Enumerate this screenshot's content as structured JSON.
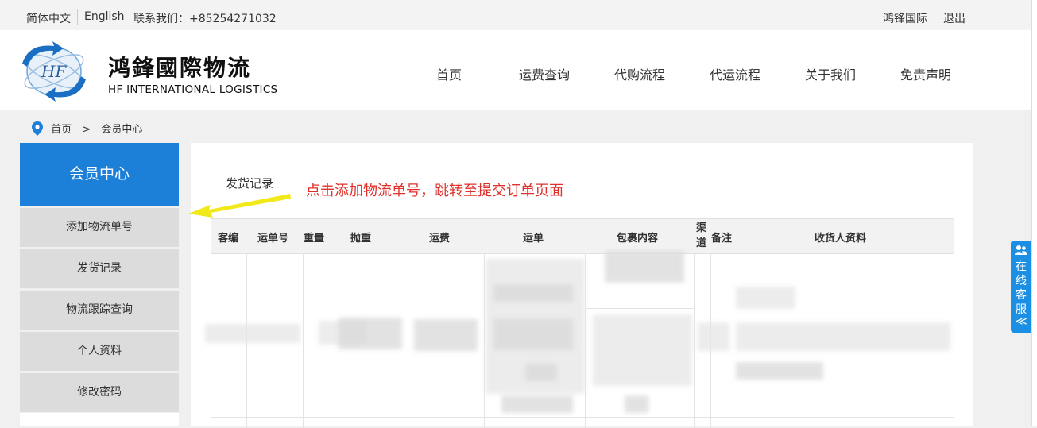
{
  "topbar": {
    "lang_cn": "简体中文",
    "lang_en": "English",
    "contact": "联系我们：+85254271032",
    "brand_link": "鸿锋国际",
    "logout": "退出"
  },
  "logo": {
    "cn": "鸿鋒國際物流",
    "en": "HF INTERNATIONAL LOGISTICS",
    "mark": "HF"
  },
  "nav": [
    "首页",
    "运费查询",
    "代购流程",
    "代运流程",
    "关于我们",
    "免责声明"
  ],
  "breadcrumb": {
    "home": "首页",
    "sep": ">",
    "current": "会员中心"
  },
  "sidebar": {
    "title": "会员中心",
    "items": [
      "添加物流单号",
      "发货记录",
      "物流跟踪查询",
      "个人资料",
      "修改密码"
    ]
  },
  "content": {
    "tab": "发货记录",
    "annotation": "点击添加物流单号，跳转至提交订单页面",
    "columns": [
      "客编",
      "运单号",
      "重量",
      "抛重",
      "运费",
      "运单",
      "包裹内容",
      "渠道",
      "备注",
      "收货人资料"
    ]
  },
  "chat": {
    "label": "在线客服",
    "collapse": "≪"
  },
  "colors": {
    "primary": "#1c80d8",
    "annotation": "#e0302b",
    "chat": "#1a8fe3"
  }
}
